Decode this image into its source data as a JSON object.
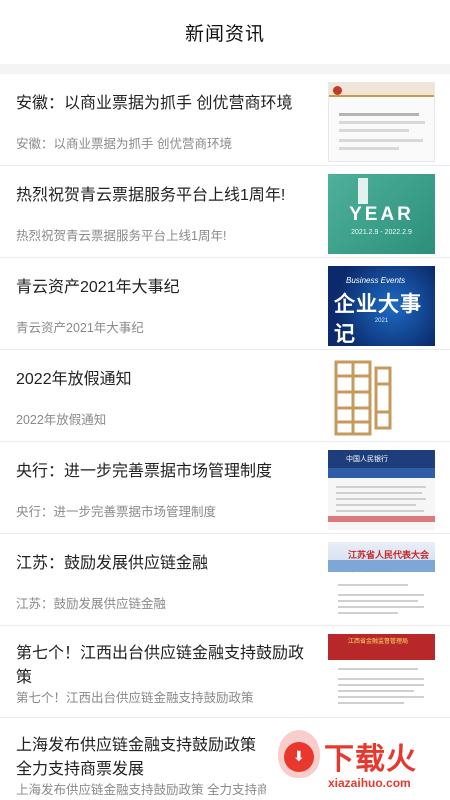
{
  "header": {
    "title": "新闻资讯"
  },
  "news": [
    {
      "title": "安徽：以商业票据为抓手 创优营商环境",
      "summary": "安徽：以商业票据为抓手 创优营商环境",
      "thumb_icon": "government-document-thumbnail"
    },
    {
      "title": "热烈祝贺青云票据服务平台上线1周年!",
      "summary": "热烈祝贺青云票据服务平台上线1周年!",
      "thumb_icon": "anniversary-year-thumbnail",
      "thumb_text": "YEAR",
      "thumb_dates": "2021.2.9 - 2022.2.9"
    },
    {
      "title": "青云资产2021年大事纪",
      "summary": "青云资产2021年大事纪",
      "thumb_icon": "business-events-thumbnail",
      "thumb_en": "Business Events",
      "thumb_cn": "企业大事记",
      "thumb_year": "2021"
    },
    {
      "title": "2022年放假通知",
      "summary": "2022年放假通知",
      "thumb_icon": "pattern-thumbnail"
    },
    {
      "title": "央行：进一步完善票据市场管理制度",
      "summary": "央行：进一步完善票据市场管理制度",
      "thumb_icon": "central-bank-page-thumbnail",
      "thumb_header": "中国人民银行"
    },
    {
      "title": "江苏：鼓励发展供应链金融",
      "summary": "江苏：鼓励发展供应链金融",
      "thumb_icon": "jiangsu-congress-thumbnail",
      "thumb_header": "江苏省人民代表大会常务委员会"
    },
    {
      "title": "第七个！江西出台供应链金融支持鼓励政策",
      "summary": "第七个！江西出台供应链金融支持鼓励政策",
      "thumb_icon": "jiangxi-government-thumbnail",
      "thumb_header": "江西省金融监督管理局"
    },
    {
      "title": "上海发布供应链金融支持鼓励政策 全力支持商票发展",
      "summary": "上海发布供应链金融支持鼓励政策 全力支持商票",
      "thumb_icon": "shanghai-thumbnail"
    }
  ],
  "watermark": {
    "cn": "下载火",
    "en": "xiazaihuo.com",
    "icon": "download-flame-logo-icon"
  },
  "colors": {
    "accent": "#e8382e",
    "title": "#222222",
    "summary": "#8a8a8a"
  }
}
